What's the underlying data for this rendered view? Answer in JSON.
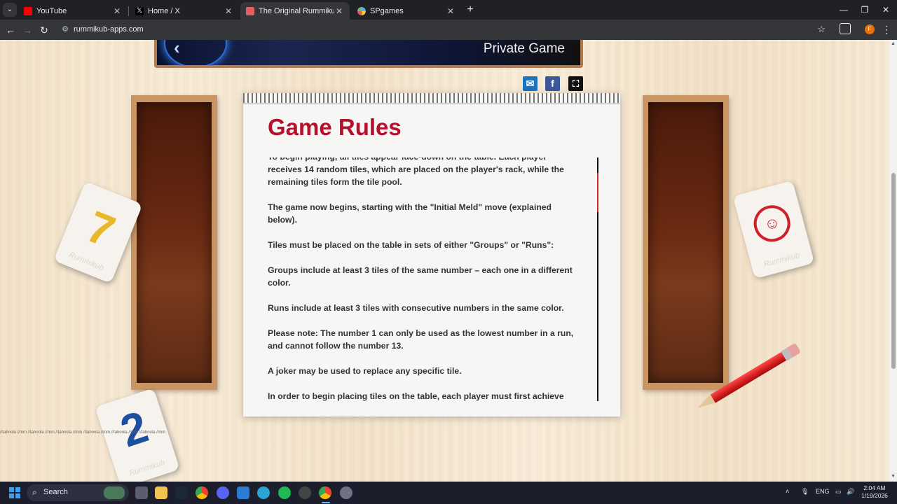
{
  "browser": {
    "tabs": [
      {
        "title": "YouTube",
        "favicon": "youtube-icon",
        "color": "#ff0000",
        "active": false
      },
      {
        "title": "Home / X",
        "favicon": "x-icon",
        "color": "#ffffff",
        "active": false
      },
      {
        "title": "The Original Rummikub",
        "favicon": "rummikub-icon",
        "color": "#e06060",
        "active": true
      },
      {
        "title": "SPgames",
        "favicon": "spgames-icon",
        "color": "#5ab0e6",
        "active": false
      }
    ],
    "url": "rummikub-apps.com",
    "profile_initial": "F"
  },
  "page": {
    "header_title": "Private Game",
    "share": {
      "email": "email-icon",
      "facebook": "facebook-icon",
      "fullscreen": "fullscreen-icon",
      "facebook_letter": "f"
    },
    "rules_title": "Game Rules",
    "rules_paragraphs": [
      "To begin playing, all tiles appear face-down on the table. Each player receives 14 random tiles, which are placed on the player's rack, while the remaining tiles form the tile pool.",
      "The game now begins, starting with the \"Initial Meld\" move (explained below).",
      "Tiles must be placed on the table in sets of either \"Groups\" or \"Runs\":",
      "Groups include at least 3 tiles of the same number – each one in a different color.",
      "Runs include at least 3 tiles with consecutive numbers in the same color.",
      "Please note: The number 1 can only be used as the lowest number in a run, and cannot follow the number 13.",
      "A joker may be used to replace any specific tile.",
      "In order to begin placing tiles on the table, each player must first achieve"
    ],
    "tiles": {
      "yellow_number": "7",
      "blue_number": "2",
      "brand": "Rummikub",
      "joker": "joker-face-icon"
    },
    "taboola_text": "//taboola //mm //taboola //mm //taboola //mm //taboola //mm //taboola //mm //taboola //mm"
  },
  "taskbar": {
    "search_label": "Search",
    "language": "ENG",
    "time": "2:04 AM",
    "date": "1/19/2026"
  },
  "colors": {
    "rules_title": "#b5112d",
    "accent_red": "#d42b2b",
    "facebook": "#3b5998",
    "email": "#1e73be"
  }
}
